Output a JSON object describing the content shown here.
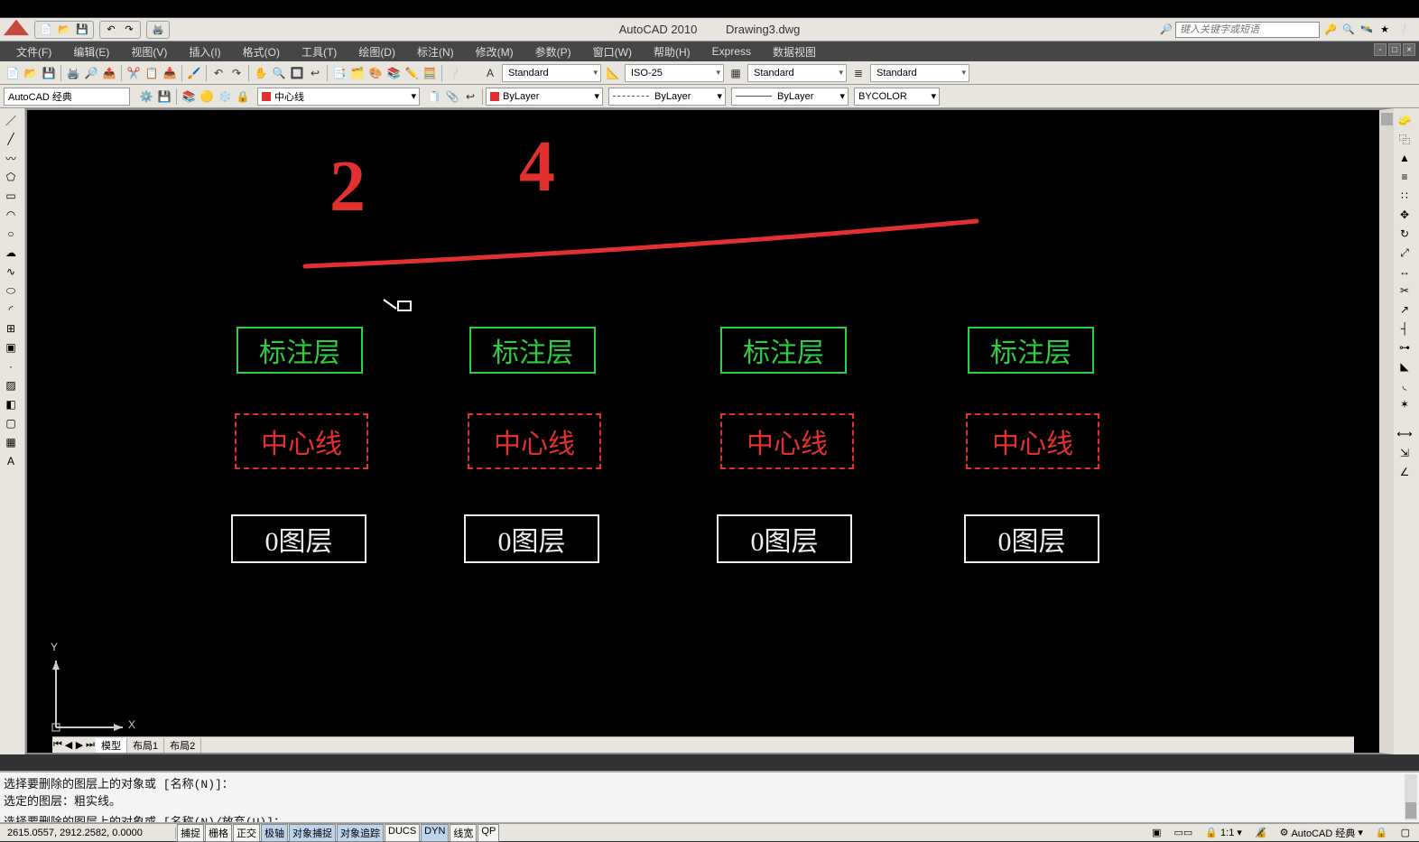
{
  "title": {
    "app": "AutoCAD 2010",
    "doc": "Drawing3.dwg"
  },
  "search": {
    "placeholder": "键入关键字或短语"
  },
  "menus": [
    "文件(F)",
    "编辑(E)",
    "视图(V)",
    "插入(I)",
    "格式(O)",
    "工具(T)",
    "绘图(D)",
    "标注(N)",
    "修改(M)",
    "参数(P)",
    "窗口(W)",
    "帮助(H)",
    "Express",
    "数据视图"
  ],
  "styles": {
    "text": "Standard",
    "dim": "ISO-25",
    "table": "Standard",
    "ml": "Standard"
  },
  "workspace": "AutoCAD 经典",
  "layer_current": "中心线",
  "props": {
    "color": "ByLayer",
    "ltype": "ByLayer",
    "lweight": "ByLayer",
    "plot": "BYCOLOR"
  },
  "model_tabs": {
    "active": "模型",
    "others": [
      "布局1",
      "布局2"
    ]
  },
  "command": {
    "l1": "选择要删除的图层上的对象或 [名称(N)]：",
    "l2": "选定的图层：粗实线。",
    "l3": "选择要删除的图层上的对象或 [名称(N)/放弃(U)]："
  },
  "status": {
    "coords": "2615.0557, 2912.2582, 0.0000",
    "toggles": [
      "捕捉",
      "栅格",
      "正交",
      "极轴",
      "对象捕捉",
      "对象追踪",
      "DUCS",
      "DYN",
      "线宽",
      "QP"
    ],
    "active": [
      "极轴",
      "对象捕捉",
      "对象追踪",
      "DYN"
    ],
    "scale": "1:1",
    "annoscale": "1:1",
    "ws": "AutoCAD 经典"
  },
  "drawing": {
    "handnum1": "2",
    "handnum2": "4",
    "row1": "标注层",
    "row2": "中心线",
    "row3": "0图层",
    "axis_x": "X",
    "axis_y": "Y"
  }
}
